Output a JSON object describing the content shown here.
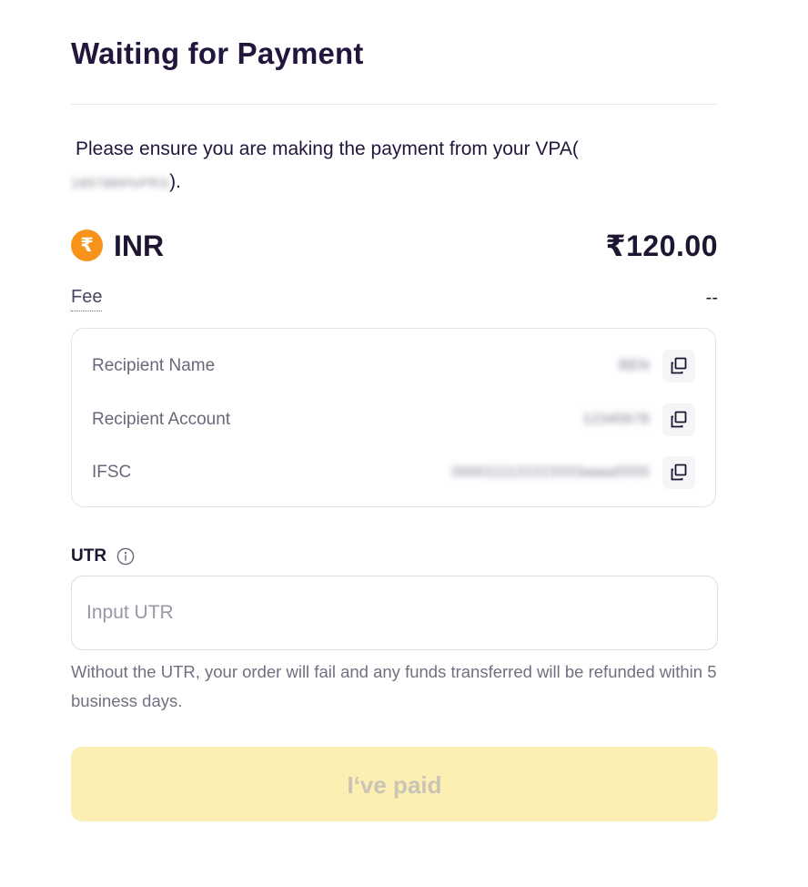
{
  "page": {
    "title": "Waiting for Payment"
  },
  "notice": {
    "text_before": "Please ensure you are making the payment from your VPA(",
    "vpa_masked": "1897889%PRS",
    "text_after": ")."
  },
  "currency": {
    "icon": "rupee-coin-icon",
    "icon_glyph": "₹",
    "icon_color": "#f7931a",
    "code": "INR",
    "amount": "₹120.00"
  },
  "fee": {
    "label": "Fee",
    "value": "--"
  },
  "recipient": {
    "rows": [
      {
        "label": "Recipient Name",
        "value": "BEN",
        "copy_icon": "copy-icon"
      },
      {
        "label": "Recipient Account",
        "value": "12345678",
        "copy_icon": "copy-icon"
      },
      {
        "label": "IFSC",
        "value": "0000111122223333aaaa5555",
        "copy_icon": "copy-icon"
      }
    ]
  },
  "utr": {
    "label": "UTR",
    "info_icon": "info-icon",
    "value": "",
    "placeholder": "Input UTR",
    "hint": "Without the UTR, your order will fail and any funds transferred will be refunded within 5 business days."
  },
  "submit": {
    "label": "I‘ve paid",
    "enabled": false,
    "bg_color": "#fbefb3"
  }
}
